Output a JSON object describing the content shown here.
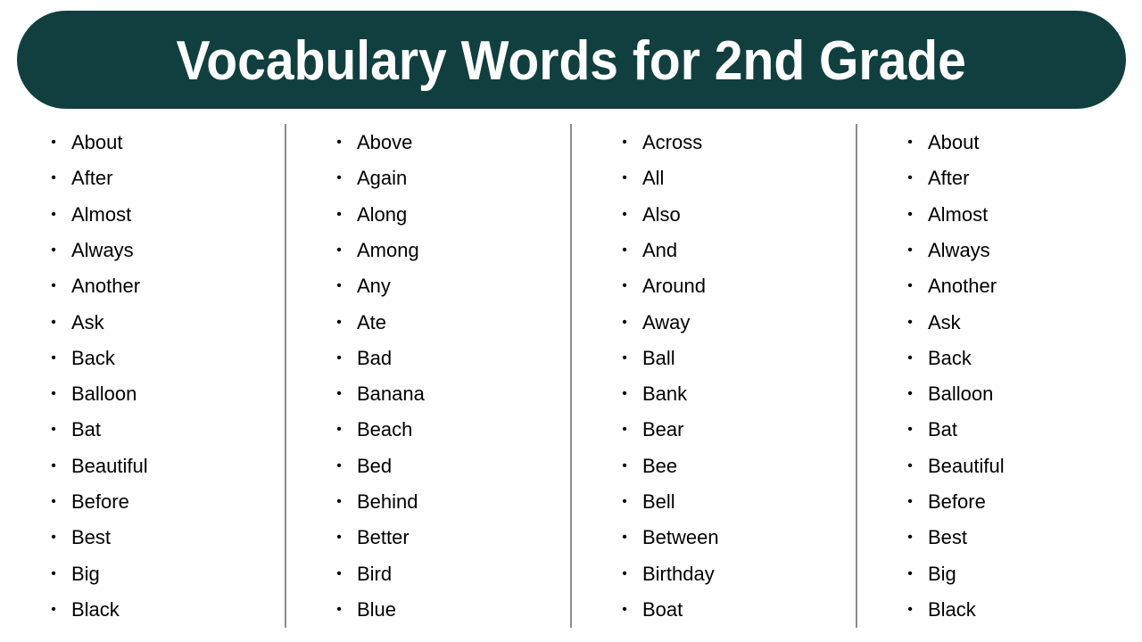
{
  "title": "Vocabulary Words for 2nd Grade",
  "colors": {
    "banner": "#113f3f",
    "banner_text": "#ffffff",
    "divider": "#8c8c8c",
    "text": "#000000"
  },
  "bullet_symbol": "•",
  "columns": [
    {
      "words": [
        "About",
        "After",
        "Almost",
        "Always",
        "Another",
        "Ask",
        "Back",
        "Balloon",
        "Bat",
        "Beautiful",
        "Before",
        "Best",
        "Big",
        "Black"
      ]
    },
    {
      "words": [
        "Above",
        "Again",
        "Along",
        "Among",
        "Any",
        "Ate",
        "Bad",
        "Banana",
        "Beach",
        "Bed",
        "Behind",
        "Better",
        "Bird",
        "Blue"
      ]
    },
    {
      "words": [
        "Across",
        "All",
        "Also",
        "And",
        "Around",
        "Away",
        "Ball",
        "Bank",
        "Bear",
        "Bee",
        "Bell",
        "Between",
        "Birthday",
        "Boat"
      ]
    },
    {
      "words": [
        "About",
        "After",
        "Almost",
        "Always",
        "Another",
        "Ask",
        "Back",
        "Balloon",
        "Bat",
        "Beautiful",
        "Before",
        "Best",
        "Big",
        "Black"
      ]
    }
  ]
}
